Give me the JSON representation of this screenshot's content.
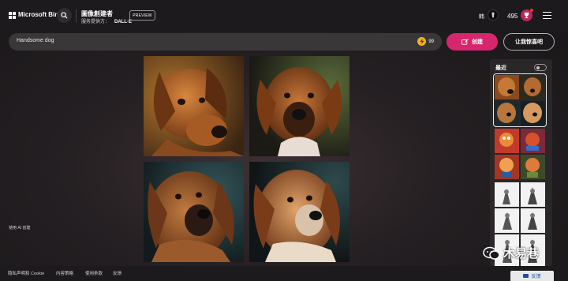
{
  "header": {
    "brand": "Microsoft Bing",
    "app_title": "圖像創建者",
    "provider_label": "服务提供方：",
    "provider_name": "DALL·E",
    "preview_label": "PREVIEW",
    "user_label": "韩",
    "points": "495"
  },
  "prompt": {
    "value": "Handsome dog",
    "boosts": "99",
    "create_label": "创建",
    "surprise_label": "让我惊喜吧"
  },
  "results": {
    "images": [
      {
        "alt": "Handsome dog image 1"
      },
      {
        "alt": "Handsome dog image 2"
      },
      {
        "alt": "Handsome dog image 3"
      },
      {
        "alt": "Handsome dog image 4"
      }
    ],
    "ai_note": "使用 AI 创建"
  },
  "recent": {
    "title": "最近",
    "toggle_on": false
  },
  "footer": {
    "links": [
      "隐私声明和 Cookie",
      "内容策略",
      "使用条款",
      "反馈"
    ],
    "feedback_button": "反馈"
  },
  "watermark": "木易巷",
  "colors": {
    "accent": "#d7266e",
    "coin": "#f2b21c",
    "background": "#241f22"
  }
}
